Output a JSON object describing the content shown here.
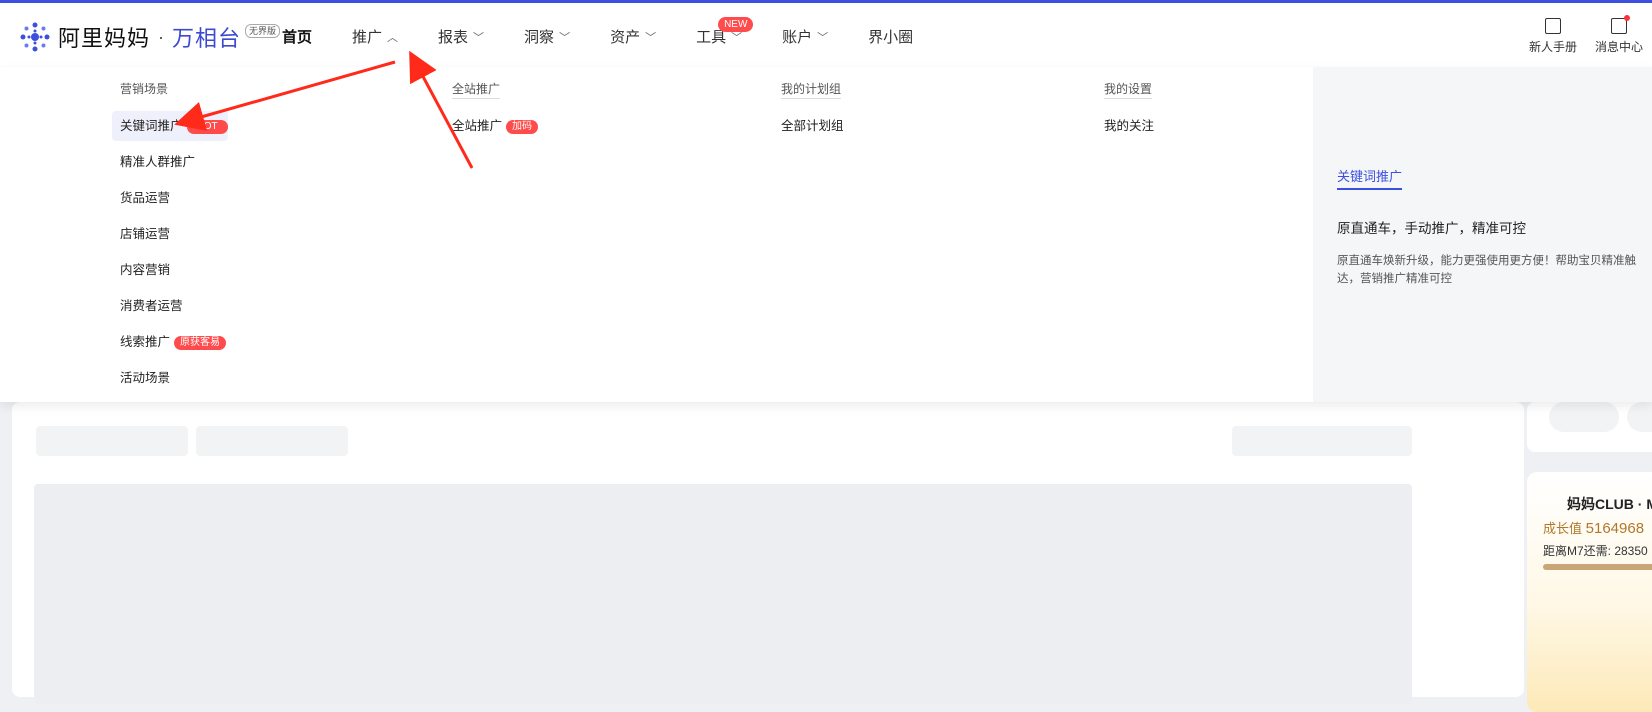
{
  "header": {
    "logo_text": "阿里妈妈",
    "logo_dot": "·",
    "logo_sub": "万相台",
    "logo_badge": "无界版",
    "nav": [
      {
        "label": "首页"
      },
      {
        "label": "推广"
      },
      {
        "label": "报表"
      },
      {
        "label": "洞察"
      },
      {
        "label": "资产"
      },
      {
        "label": "工具",
        "badge": "NEW"
      },
      {
        "label": "账户"
      },
      {
        "label": "界小圈"
      }
    ],
    "tools": [
      {
        "label": "新人手册",
        "icon": "manual-icon"
      },
      {
        "label": "消息中心",
        "icon": "message-icon"
      }
    ]
  },
  "dropdown": {
    "marketing": {
      "title": "营销场景",
      "items": [
        {
          "label": "关键词推广",
          "tag": "HOT"
        },
        {
          "label": "精准人群推广"
        },
        {
          "label": "货品运营"
        },
        {
          "label": "店铺运营"
        },
        {
          "label": "内容营销"
        },
        {
          "label": "消费者运营"
        },
        {
          "label": "线索推广",
          "tag": "原获客易"
        },
        {
          "label": "活动场景"
        }
      ]
    },
    "site": {
      "title": "全站推广",
      "item": "全站推广",
      "tag": "加码"
    },
    "plans": {
      "title": "我的计划组",
      "item": "全部计划组"
    },
    "settings": {
      "title": "我的设置",
      "item": "我的关注"
    },
    "info": {
      "title": "关键词推广",
      "headline": "原直通车，手动推广，精准可控",
      "desc": "原直通车焕新升级，能力更强使用更方便！帮助宝贝精准触达，营销推广精准可控"
    }
  },
  "club": {
    "title": "妈妈CLUB · M",
    "value_label": "成长值",
    "value": "5164968",
    "remain": "距离M7还需: 28350"
  },
  "colors": {
    "accent": "#3c50e0",
    "tag_red": "#ff4b4b",
    "annotation": "#ff2a1a"
  }
}
